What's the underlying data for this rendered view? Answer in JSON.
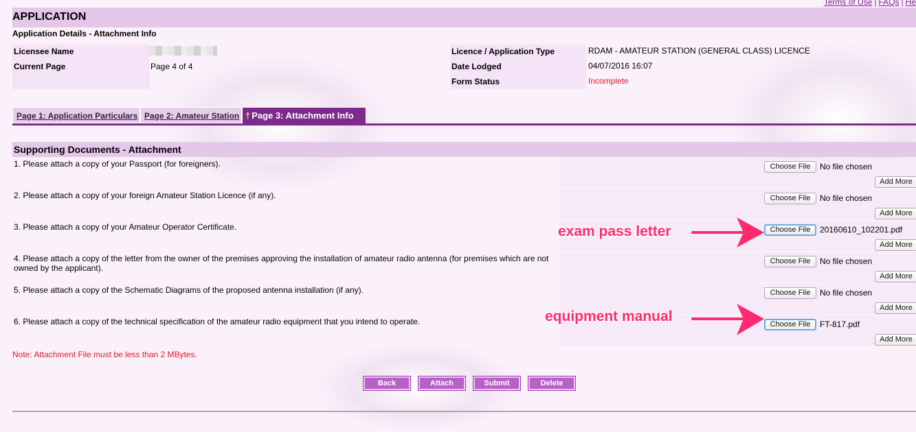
{
  "top_links": {
    "terms": "Terms of Use",
    "faqs": "FAQs",
    "help": "He"
  },
  "title": "APPLICATION",
  "subtitle": "Application Details - Attachment Info",
  "info": {
    "licensee_label": "Licensee Name",
    "current_page_label": "Current Page",
    "current_page_value": "Page 4 of 4",
    "licence_type_label": "Licence / Application Type",
    "licence_type_value": "RDAM - AMATEUR STATION (GENERAL CLASS) LICENCE",
    "date_lodged_label": "Date Lodged",
    "date_lodged_value": "04/07/2016 16:07",
    "form_status_label": "Form Status",
    "form_status_value": "Incomplete",
    "form_status_color": "#d6202a"
  },
  "tabs": [
    {
      "label": "Page 1: Application Particulars"
    },
    {
      "label": "Page 2: Amateur Station"
    },
    {
      "marker": "†",
      "label": "Page 3: Attachment Info"
    }
  ],
  "section_title": "Supporting Documents - Attachment",
  "attachments": [
    {
      "question": "1. Please attach a copy of your Passport (for foreigners).",
      "choose_label": "Choose File",
      "file_status": "No file chosen",
      "add_more_label": "Add More"
    },
    {
      "question": "2. Please attach a copy of your foreign Amateur Station Licence (if any).",
      "choose_label": "Choose File",
      "file_status": "No file chosen",
      "add_more_label": "Add More"
    },
    {
      "question": "3. Please attach a copy of your Amateur Operator Certificate.",
      "choose_label": "Choose File",
      "file_status": "20160610_102201.pdf",
      "add_more_label": "Add More"
    },
    {
      "question": "4. Please attach a copy of the letter from the owner of the premises approving the installation of amateur radio antenna (for premises which are not owned by the applicant).",
      "choose_label": "Choose File",
      "file_status": "No file chosen",
      "add_more_label": "Add More"
    },
    {
      "question": "5. Please attach a copy of the Schematic Diagrams of the proposed antenna installation (if any).",
      "choose_label": "Choose File",
      "file_status": "No file chosen",
      "add_more_label": "Add More"
    },
    {
      "question": "6. Please attach a copy of the technical specification of the amateur radio equipment that you intend to operate.",
      "choose_label": "Choose File",
      "file_status": "FT-817.pdf",
      "add_more_label": "Add More"
    }
  ],
  "note": "Note: Attachment File must be less than 2 MBytes.",
  "actions": {
    "back": "Back",
    "attach": "Attach",
    "submit": "Submit",
    "delete": "Delete"
  },
  "annotations": {
    "exam_pass_letter": "exam pass letter",
    "equipment_manual": "equipment manual",
    "color": "#ff2a6d"
  },
  "colors": {
    "accent_purple": "#7d2a8e",
    "header_bg": "#e5c7ea",
    "button_purple": "#b760c8"
  }
}
